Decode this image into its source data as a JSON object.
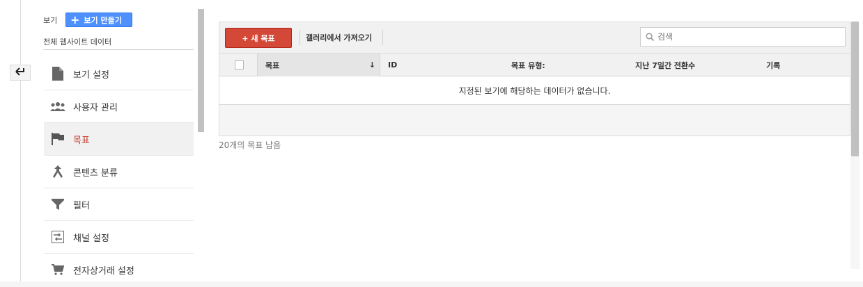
{
  "view": {
    "label": "보기",
    "create_button": "보기 만들기",
    "name": "전체 웹사이트 데이터"
  },
  "back_icon": "back-arrow-icon",
  "nav": {
    "items": [
      {
        "label": "보기 설정",
        "icon": "document-icon"
      },
      {
        "label": "사용자 관리",
        "icon": "people-icon"
      },
      {
        "label": "목표",
        "icon": "flag-icon",
        "active": true
      },
      {
        "label": "콘텐츠 분류",
        "icon": "merge-icon"
      },
      {
        "label": "필터",
        "icon": "filter-icon"
      },
      {
        "label": "채널 설정",
        "icon": "channel-icon"
      },
      {
        "label": "전자상거래 설정",
        "icon": "cart-icon"
      }
    ]
  },
  "toolbar": {
    "new_goal": "+ 새 목표",
    "import_gallery": "갤러리에서 가져오기",
    "search_placeholder": "검색"
  },
  "table": {
    "columns": [
      "목표",
      "ID",
      "목표 유형:",
      "지난 7일간 전환수",
      "기록"
    ],
    "empty_message": "지정된 보기에 해당하는 데이터가 없습니다."
  },
  "footer": {
    "remaining": "20개의 목표 남음"
  },
  "colors": {
    "accent_red": "#d34836",
    "accent_blue": "#4d90fe",
    "active_text": "#c53727"
  }
}
